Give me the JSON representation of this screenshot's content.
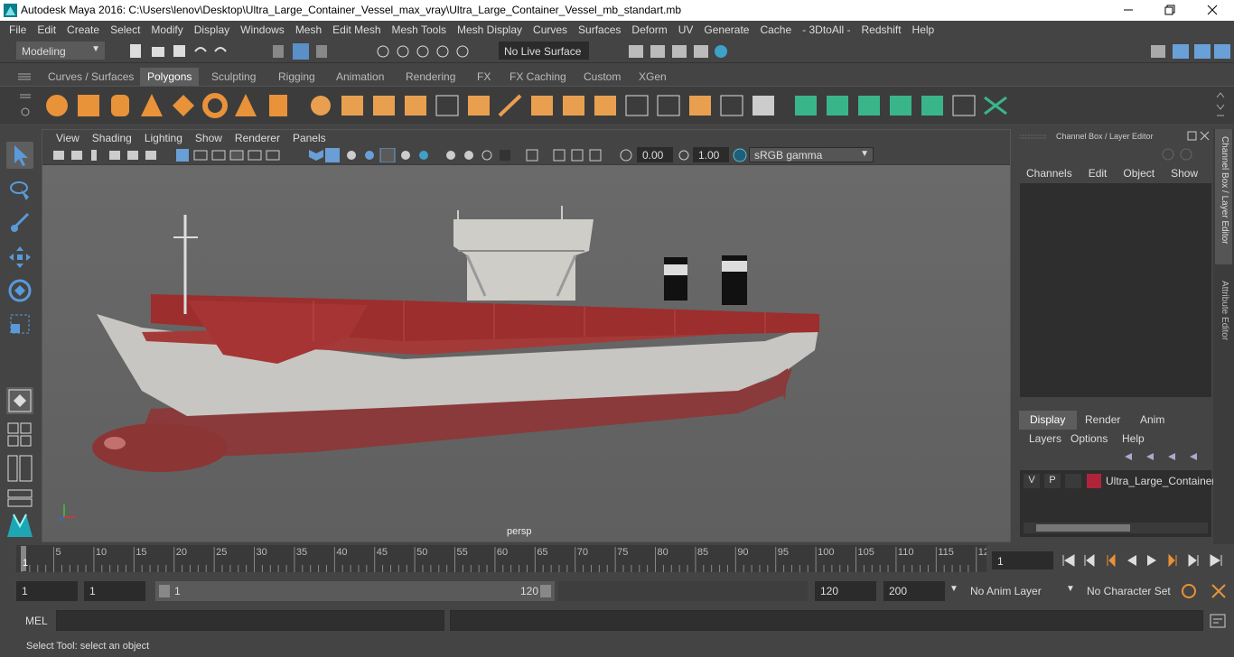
{
  "window": {
    "title": "Autodesk Maya 2016: C:\\Users\\lenov\\Desktop\\Ultra_Large_Container_Vessel_max_vray\\Ultra_Large_Container_Vessel_mb_standart.mb"
  },
  "menubar": [
    "File",
    "Edit",
    "Create",
    "Select",
    "Modify",
    "Display",
    "Windows",
    "Mesh",
    "Edit Mesh",
    "Mesh Tools",
    "Mesh Display",
    "Curves",
    "Surfaces",
    "Deform",
    "UV",
    "Generate",
    "Cache",
    "- 3DtoAll -",
    "Redshift",
    "Help"
  ],
  "statusline": {
    "mode": "Modeling",
    "live_surface": "No Live Surface"
  },
  "shelf_tabs": [
    "Curves / Surfaces",
    "Polygons",
    "Sculpting",
    "Rigging",
    "Animation",
    "Rendering",
    "FX",
    "FX Caching",
    "Custom",
    "XGen"
  ],
  "shelf_active": "Polygons",
  "viewport": {
    "menu": [
      "View",
      "Shading",
      "Lighting",
      "Show",
      "Renderer",
      "Panels"
    ],
    "exposure": "0.00",
    "gamma": "1.00",
    "colorspace": "sRGB gamma",
    "camera": "persp"
  },
  "channel_box": {
    "title": "Channel Box / Layer Editor",
    "menu": [
      "Channels",
      "Edit",
      "Object",
      "Show"
    ]
  },
  "layer_editor": {
    "tabs": [
      "Display",
      "Render",
      "Anim"
    ],
    "menu": [
      "Layers",
      "Options",
      "Help"
    ],
    "layer": {
      "v": "V",
      "p": "P",
      "name": "Ultra_Large_Container",
      "color": "#b0243a"
    }
  },
  "side_tabs": {
    "channel": "Channel Box / Layer Editor",
    "attribute": "Attribute Editor"
  },
  "timeline": {
    "ticks": [
      "5",
      "10",
      "15",
      "20",
      "25",
      "30",
      "35",
      "40",
      "45",
      "50",
      "55",
      "60",
      "65",
      "70",
      "75",
      "80",
      "85",
      "90",
      "95",
      "100",
      "105",
      "110",
      "115",
      "12"
    ],
    "current": "1",
    "frame_field": "1"
  },
  "range": {
    "start": "1",
    "anim_start": "1",
    "slider_start": "1",
    "slider_end": "120",
    "end": "120",
    "anim_end": "200",
    "anim_layer": "No Anim Layer",
    "char_set": "No Character Set"
  },
  "mel": {
    "label": "MEL"
  },
  "help": {
    "text": "Select Tool: select an object"
  }
}
